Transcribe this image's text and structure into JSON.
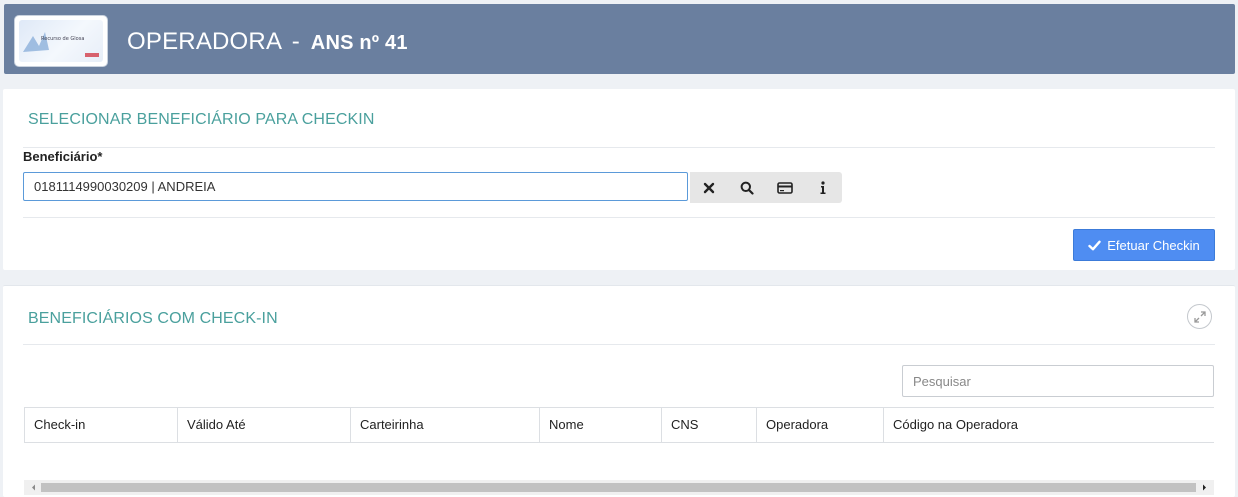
{
  "header": {
    "logo_text": "Recurso de Glosa",
    "title": "OPERADORA",
    "separator": "-",
    "ans": "ANS nº 41"
  },
  "checkin_section": {
    "title": "SELECIONAR BENEFICIÁRIO PARA CHECKIN",
    "field_label": "Beneficiário*",
    "field_value": "0181114990030209 | ANDREIA",
    "addons": [
      "times-icon",
      "search-icon",
      "card-icon",
      "info-icon"
    ],
    "submit_label": "Efetuar Checkin"
  },
  "list_section": {
    "title": "BENEFICIÁRIOS COM CHECK-IN",
    "search_placeholder": "Pesquisar",
    "columns": [
      "Check-in",
      "Válido Até",
      "Carteirinha",
      "Nome",
      "CNS",
      "Operadora",
      "Código na Operadora"
    ],
    "rows": []
  },
  "colors": {
    "header_bg": "#6a7f9f",
    "section_title": "#4aa09d",
    "primary_button": "#4f8df2",
    "input_focus": "#5b9ad9"
  }
}
